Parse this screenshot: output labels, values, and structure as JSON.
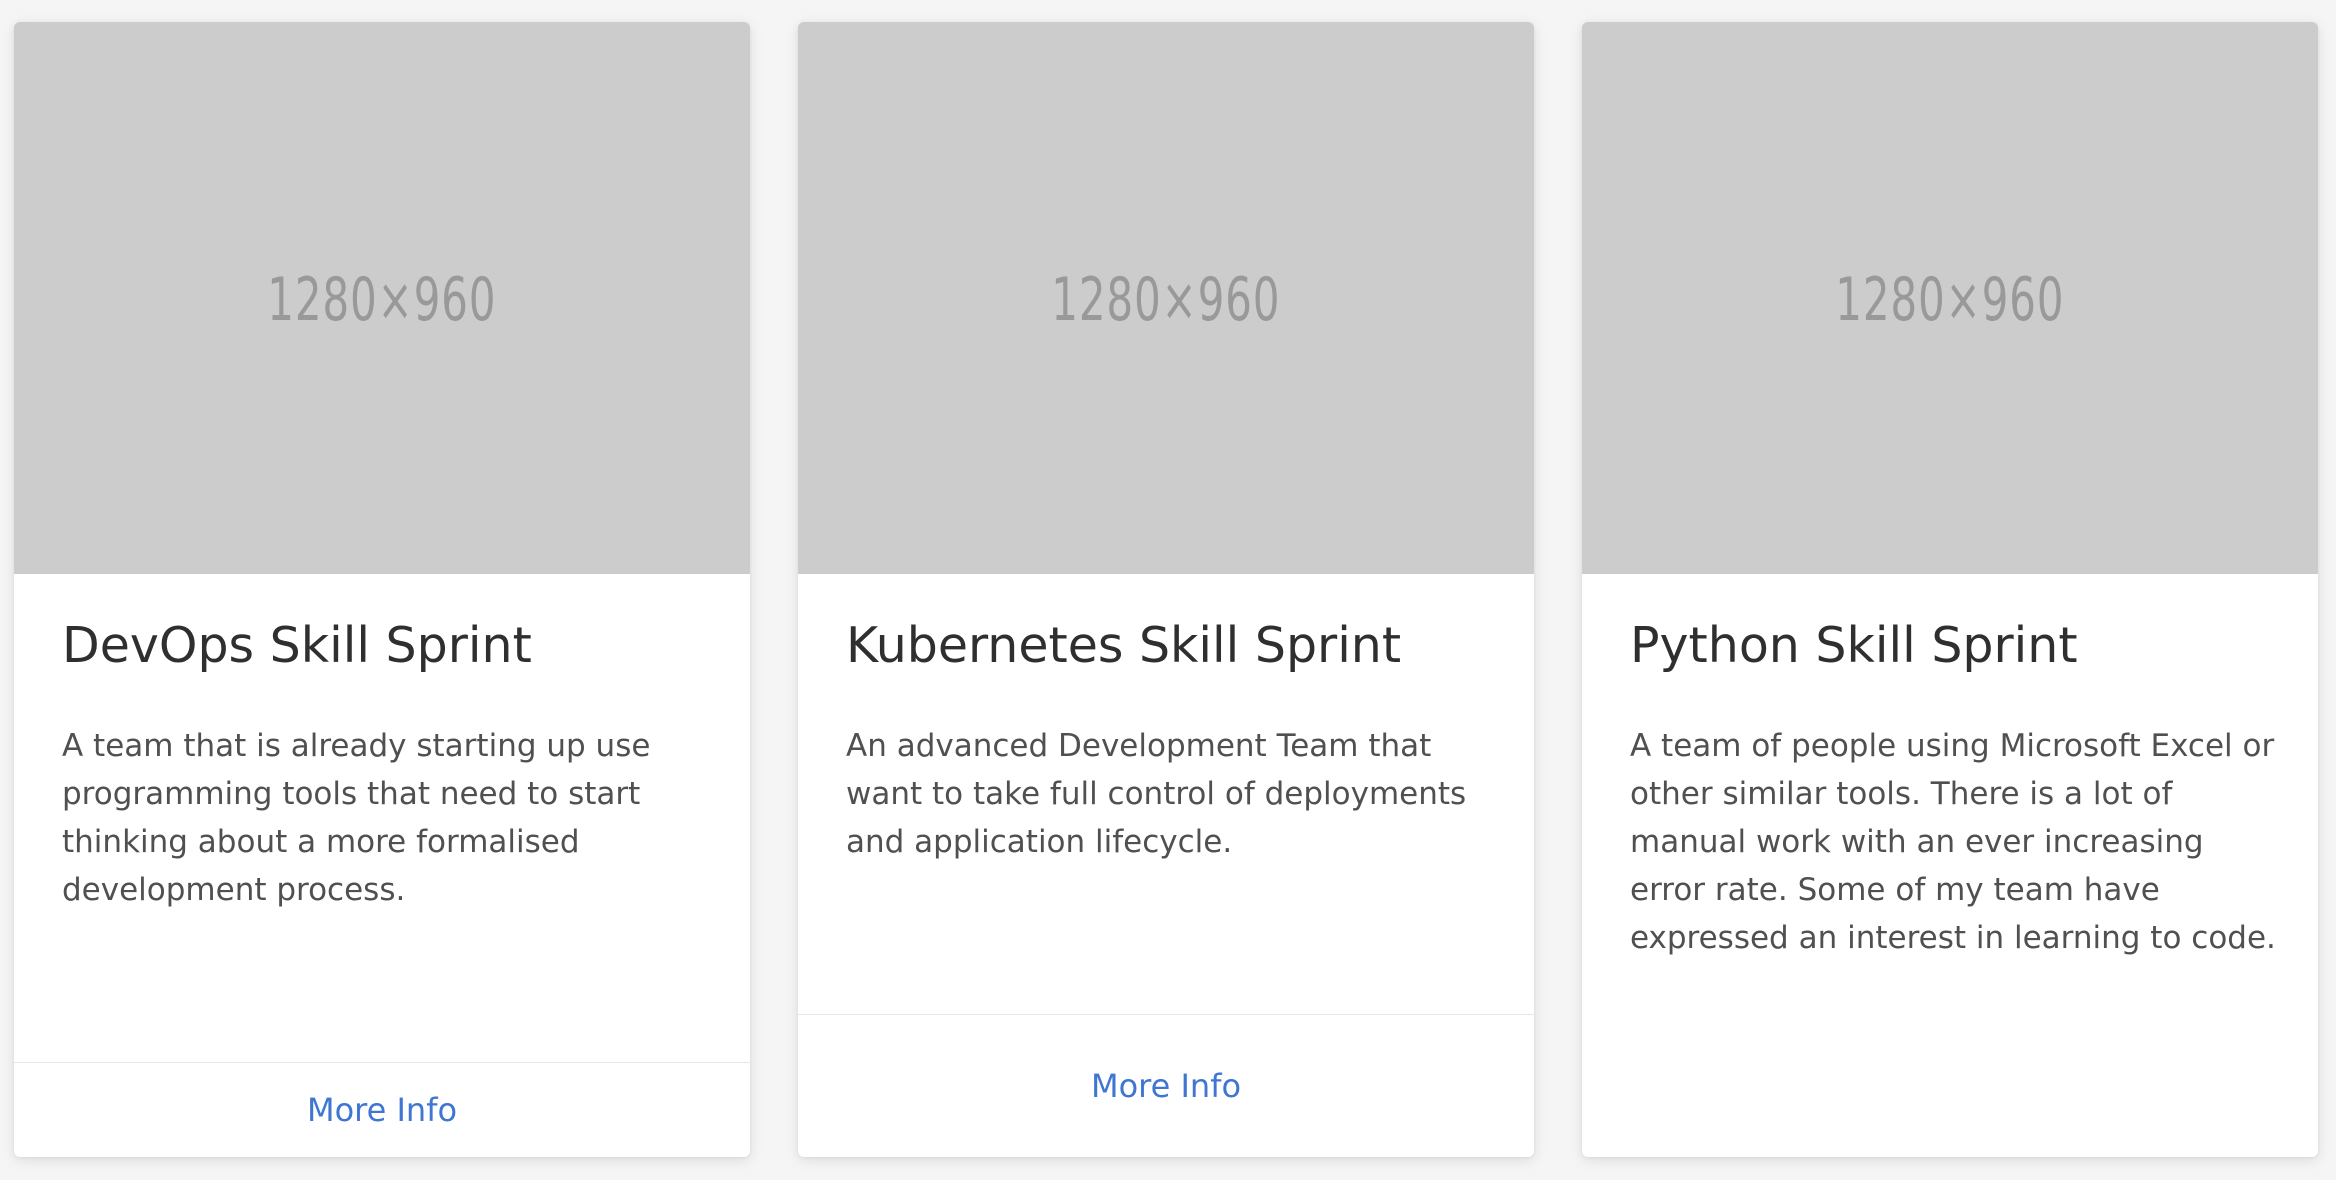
{
  "cards": [
    {
      "image_label": "1280×960",
      "title": "DevOps Skill Sprint",
      "description": "A team that is already starting up use programming tools that need to start thinking about a more formalised development process.",
      "link_label": "More Info"
    },
    {
      "image_label": "1280×960",
      "title": "Kubernetes Skill Sprint",
      "description": "An advanced Development Team that want to take full control of deployments and application lifecycle.",
      "link_label": "More Info"
    },
    {
      "image_label": "1280×960",
      "title": "Python Skill Sprint",
      "description": "A team of people using Microsoft Excel or other similar tools. There is a lot of manual work with an ever increasing error rate. Some of my team have expressed an interest in learning to code."
    }
  ],
  "colors": {
    "placeholder_bg": "#cccccc",
    "placeholder_text": "#999999",
    "link": "#3f76d2",
    "title": "#2f2f2f",
    "body_text": "#505050"
  }
}
